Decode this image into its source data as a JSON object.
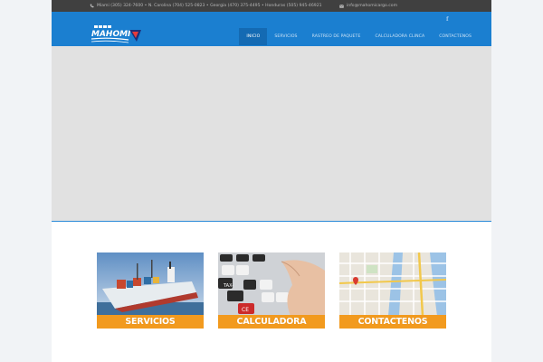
{
  "topbar": {
    "phones": "Miami (305) 324-7600 • N. Carolina (704) 525-0823 • Georgia (470) 375-4495 • Honduras (505) 945-46921",
    "email": "info@mahomicargo.com",
    "phone_icon": "phone-icon",
    "mail_icon": "envelope-icon",
    "facebook": "f"
  },
  "brand": {
    "logo_text": "MAHOMI",
    "accent": "#1b7fd0",
    "orange": "#f29a1e"
  },
  "nav": {
    "items": [
      {
        "label": "INICIO",
        "active": true
      },
      {
        "label": "SERVICIOS",
        "active": false
      },
      {
        "label": "RASTREO DE PAQUETE",
        "active": false
      },
      {
        "label": "CALCULADORA CLINCA",
        "active": false
      },
      {
        "label": "CONTACTENOS",
        "active": false
      }
    ]
  },
  "cards": [
    {
      "label": "SERVICIOS",
      "image": "cargo-ship"
    },
    {
      "label": "CALCULADORA",
      "image": "calculator-keys"
    },
    {
      "label": "CONTACTENOS",
      "image": "street-map"
    }
  ]
}
